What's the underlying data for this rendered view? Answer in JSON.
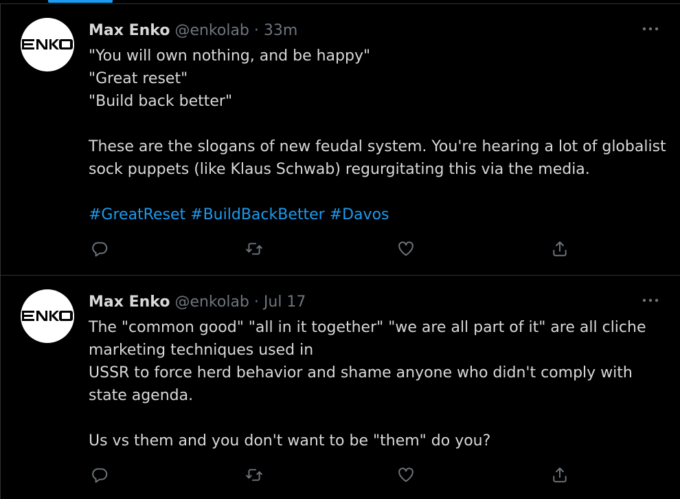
{
  "tweets": [
    {
      "author": {
        "name": "Max Enko",
        "handle": "@enkolab",
        "avatar_text": "ENKO"
      },
      "separator": "·",
      "time": "33m",
      "lines": [
        "\"You will own nothing, and be happy\"",
        "\"Great reset\"",
        "\"Build back better\"",
        "",
        "These are the slogans of new feudal system. You're hearing a lot of globalist",
        "sock puppets (like Klaus Schwab) regurgitating this via the media.",
        ""
      ],
      "hashtags": [
        "#GreatReset",
        "#BuildBackBetter",
        "#Davos"
      ]
    },
    {
      "author": {
        "name": "Max Enko",
        "handle": "@enkolab",
        "avatar_text": "ENKO"
      },
      "separator": "·",
      "time": "Jul 17",
      "lines": [
        "The \"common good\" \"all in it together\" \"we are all part of it\" are all cliche",
        "marketing techniques used in",
        "USSR to force herd behavior and shame anyone who didn't comply with",
        "state agenda.",
        "",
        "Us vs them and you don't want to be \"them\" do you?"
      ],
      "hashtags": []
    }
  ],
  "icons": {
    "reply": "reply-icon",
    "retweet": "retweet-icon",
    "like": "like-icon",
    "share": "share-icon",
    "more": "more-icon"
  },
  "colors": {
    "background": "#000000",
    "text": "#d9d9d9",
    "secondary": "#6e767d",
    "accent": "#1d9bf0",
    "border": "#2f3336"
  }
}
